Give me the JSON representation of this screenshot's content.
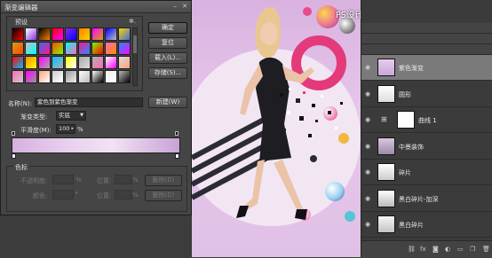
{
  "dialog": {
    "title": "渐变编辑器",
    "presets_label": "预设",
    "buttons": {
      "ok": "确定",
      "reset": "复位",
      "load": "载入(L)...",
      "save": "存储(S)...",
      "new": "新建(W)"
    },
    "name_label": "名称(N):",
    "name_value": "紫色到紫色渐变",
    "gradient_type_label": "渐变类型:",
    "gradient_type_value": "实底",
    "smoothness_label": "平滑度(M):",
    "smoothness_value": "100",
    "smoothness_unit": "%",
    "stops_label": "色标",
    "opacity_label": "不透明度:",
    "opacity_unit": "%",
    "color_label": "颜色:",
    "location_label": "位置:",
    "location_unit": "%",
    "delete_label": "删除(D)",
    "swatch_colors": [
      "#000000",
      "#ffffff",
      "#000000",
      "#ff0000",
      "#8a2be2",
      "#ff7f00",
      "#ff00ff",
      "#0000ff",
      "#ffd700",
      "#d4a017",
      "#c0c0c0",
      "#4169e1",
      "#ff4500",
      "#00ffff",
      "#ff1493",
      "#7cfc00",
      "#ff69b4",
      "#1e90ff",
      "#ff0000",
      "#ff8c00",
      "#ff00ff",
      "#00bfff",
      "#ffff00",
      "#a9a9a9",
      "#b0b0b0",
      "#ffffff",
      "#dddddd",
      "#ff69b4",
      "#ff00ff",
      "#ffa07a",
      "#cccccc",
      "#999999",
      "#ffffff",
      "#ffffff",
      "#eeeeee",
      "#bbbbbb"
    ]
  },
  "watermark": "PS设计教程网 WWW.MISSYUAN.COM",
  "layers": {
    "items": [
      {
        "name": "紫色渐变",
        "selected": true
      },
      {
        "name": "圆形",
        "selected": false
      },
      {
        "name": "曲线 1",
        "selected": false
      },
      {
        "name": "中景装饰",
        "selected": false
      },
      {
        "name": "碎片",
        "selected": false
      },
      {
        "name": "黑白碎片-加深",
        "selected": false
      },
      {
        "name": "黑白碎片",
        "selected": false
      }
    ],
    "bottom_icons": [
      "link-icon",
      "fx-icon",
      "mask-icon",
      "adjustment-icon",
      "folder-icon",
      "new-layer-icon",
      "trash-icon"
    ]
  }
}
